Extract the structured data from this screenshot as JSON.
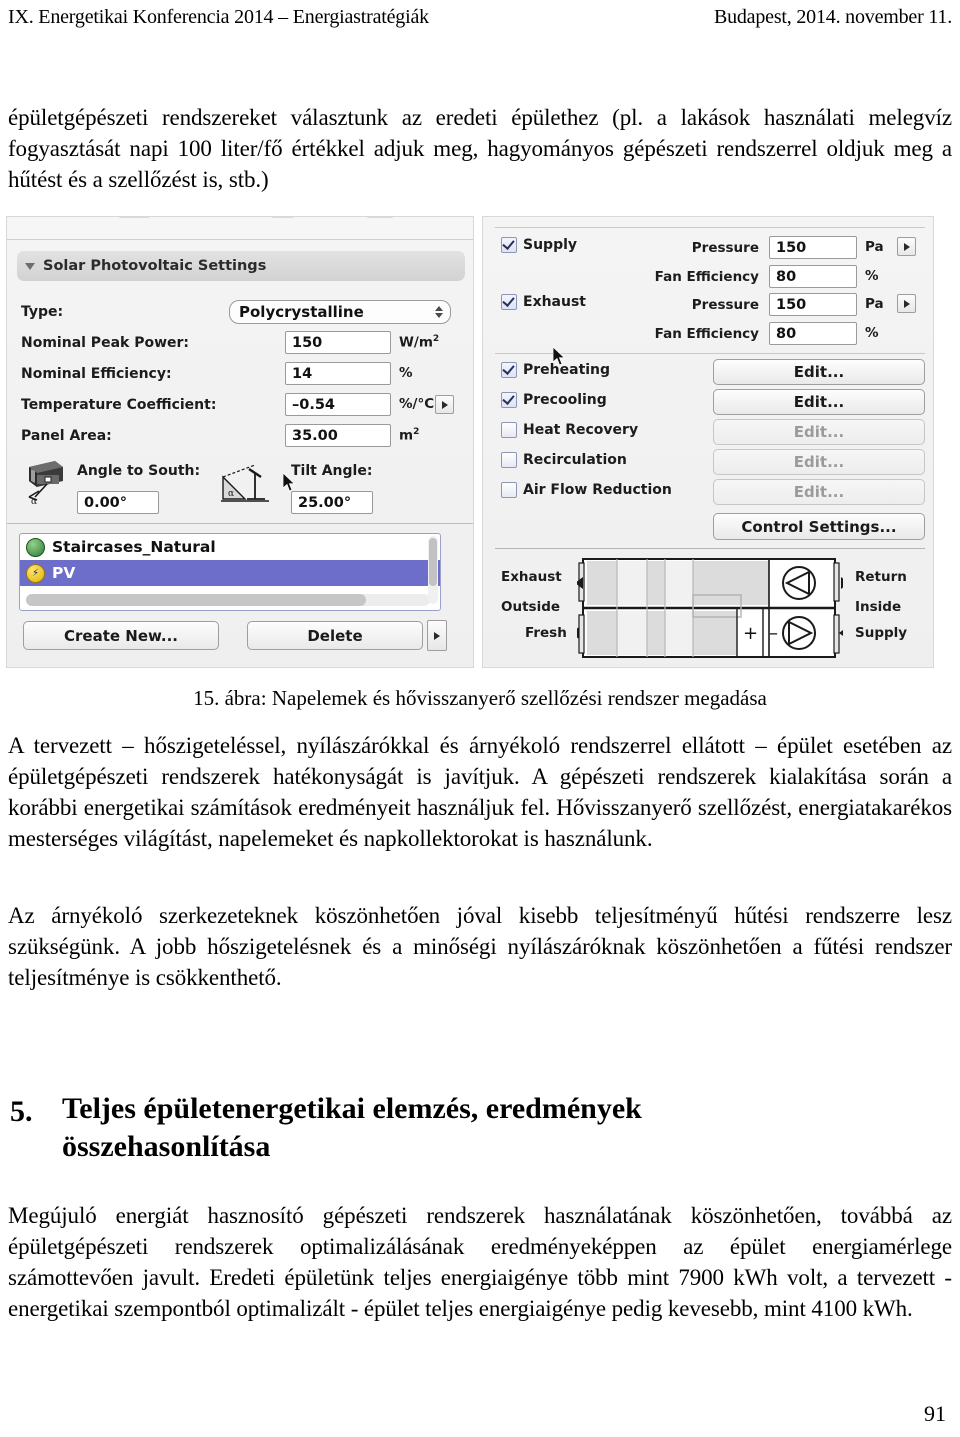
{
  "running_head": {
    "left": "IX. Energetikai Konferencia 2014 – Energiastratégiák",
    "right": "Budapest, 2014. november 11."
  },
  "paragraphs": {
    "top": "épületgépészeti rendszereket választunk az eredeti épülethez (pl. a lakások használati melegvíz fogyasztását napi 100 liter/fő értékkel adjuk meg, hagyományos gépészeti rendszerrel oldjuk meg a hűtést és a szellőzést is, stb.)",
    "after_figure": "A tervezett – hőszigeteléssel, nyílászárókkal és árnyékoló rendszerrel ellátott – épület esetében az épületgépészeti rendszerek hatékonyságát is javítjuk. A gépészeti rendszerek kialakítása során a korábbi energetikai számítások eredményeit használjuk fel. Hővisszanyerő szellőzést, energiatakarékos mesterséges világítást, napelemeket és napkollektorokat is használunk.",
    "shading": "Az árnyékoló szerkezeteknek köszönhetően jóval kisebb teljesítményű hűtési rendszerre lesz szükségünk. A jobb hőszigetelésnek és a minőségi nyílászáróknak köszönhetően a fűtési rendszer teljesítménye is csökkenthető.",
    "results": "Megújuló energiát hasznosító gépészeti rendszerek használatának köszönhetően, továbbá az épületgépészeti rendszerek optimalizálásának eredményeképpen az épület energiamérlege számottevően javult. Eredeti épületünk teljes energiaigénye több mint 7900 kWh volt, a tervezett - energetikai szempontból optimalizált - épület teljes energiaigénye pedig kevesebb, mint 4100 kWh."
  },
  "figure": {
    "caption": "15. ábra: Napelemek és hővisszanyerő szellőzési rendszer megadása",
    "left_panel": {
      "group_title": "Solar Photovoltaic Settings",
      "fields": [
        {
          "label": "Type:",
          "value": "Polycrystalline",
          "unit": "",
          "kind": "popup"
        },
        {
          "label": "Nominal Peak Power:",
          "value": "150",
          "unit": "W/m²",
          "kind": "text"
        },
        {
          "label": "Nominal Efficiency:",
          "value": "14",
          "unit": "%",
          "kind": "text"
        },
        {
          "label": "Temperature Coefficient:",
          "value": "–0.54",
          "unit": "%/°C",
          "kind": "text"
        },
        {
          "label": "Panel Area:",
          "value": "35.00",
          "unit": "m²",
          "kind": "text"
        }
      ],
      "angle_to_south": {
        "label": "Angle to South:",
        "value": "0.00°"
      },
      "tilt_angle": {
        "label": "Tilt Angle:",
        "value": "25.00°"
      },
      "list_items": [
        {
          "name": "Staircases_Natural",
          "selected": false,
          "icon": "green-globe-icon"
        },
        {
          "name": "PV",
          "selected": true,
          "icon": "yellow-bolt-icon"
        }
      ],
      "buttons": {
        "create": "Create New...",
        "delete": "Delete"
      }
    },
    "right_panel": {
      "fan_sections": [
        {
          "checkbox_label": "Supply",
          "checked": true,
          "rows": [
            {
              "label": "Pressure",
              "value": "150",
              "unit": "Pa"
            },
            {
              "label": "Fan Efficiency",
              "value": "80",
              "unit": "%"
            }
          ]
        },
        {
          "checkbox_label": "Exhaust",
          "checked": true,
          "rows": [
            {
              "label": "Pressure",
              "value": "150",
              "unit": "Pa"
            },
            {
              "label": "Fan Efficiency",
              "value": "80",
              "unit": "%"
            }
          ]
        }
      ],
      "options": [
        {
          "label": "Preheating",
          "checked": true,
          "button": "Edit...",
          "enabled": true
        },
        {
          "label": "Precooling",
          "checked": true,
          "button": "Edit...",
          "enabled": true
        },
        {
          "label": "Heat Recovery",
          "checked": false,
          "button": "Edit...",
          "enabled": false
        },
        {
          "label": "Recirculation",
          "checked": false,
          "button": "Edit...",
          "enabled": false
        },
        {
          "label": "Air Flow Reduction",
          "checked": false,
          "button": "Edit...",
          "enabled": false
        }
      ],
      "control_settings_button": "Control Settings...",
      "diagram": {
        "left_labels": [
          "Exhaust",
          "Outside",
          "Fresh"
        ],
        "right_labels": [
          "Return",
          "Inside",
          "Supply"
        ],
        "mix_plus": "+",
        "mix_minus": "–"
      }
    }
  },
  "section": {
    "number": "5.",
    "title_line1": "Teljes épületenergetikai elemzés, eredmények",
    "title_line2": "összehasonlítása"
  },
  "page_number": "91",
  "colors": {
    "selection": "#6d6dca",
    "panel_bg": "#f2f2f2",
    "checkbox_border": "#8f96b4"
  }
}
